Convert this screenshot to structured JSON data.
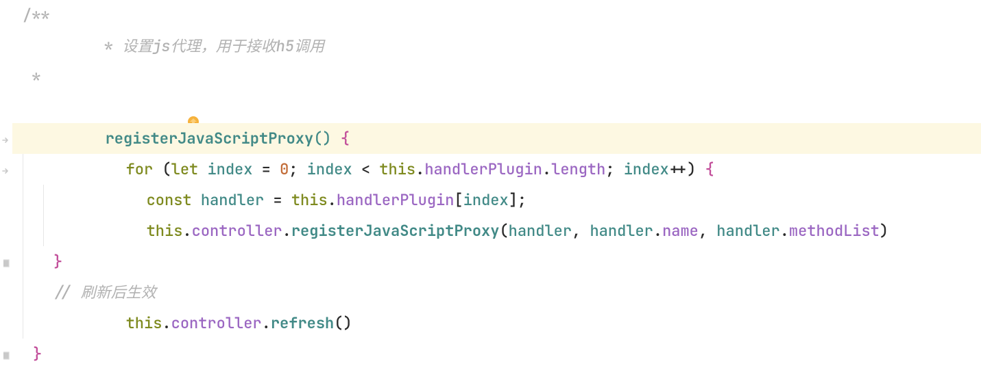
{
  "comment": {
    "open": "/**",
    "line1_prefix": " * ",
    "line1_text": "设置js代理，用于接收h5调用",
    "line2": " *",
    "close": " */",
    "line2_suffix_inline": "// 刷新后生效"
  },
  "code": {
    "method_name": "registerJavaScriptProxy",
    "empty_parens": "()",
    "open_brace": "{",
    "close_brace": "}",
    "for_kw": "for",
    "let_kw": "let",
    "const_kw": "const",
    "index_var": "index",
    "handler_var": "handler",
    "this_kw": "this",
    "assign": " = ",
    "zero": "0",
    "semi": ";",
    "lt": " < ",
    "inc": "++",
    "handlerPlugin": "handlerPlugin",
    "length_prop": "length",
    "controller_prop": "controller",
    "register_call": "registerJavaScriptProxy",
    "refresh_call": "refresh",
    "name_prop": "name",
    "methodList_prop": "methodList",
    "comma_sp": ", ",
    "open_paren": "(",
    "close_paren": ")",
    "open_bracket": "[",
    "close_bracket": "]",
    "refresh_comment": "// 刷新后生效",
    "dot": "."
  },
  "icons": {
    "bulb": "hint-bulb-icon",
    "goto": "goto-arrow-icon",
    "close_marker": "fold-close-icon"
  },
  "colors": {
    "highlight_bg": "#fdf8e2",
    "comment": "#b2b2b2",
    "keyword": "#7e8a1f",
    "identifier": "#428a87",
    "member": "#9b67c2",
    "number": "#c26c38",
    "brace": "#c24e9a"
  }
}
